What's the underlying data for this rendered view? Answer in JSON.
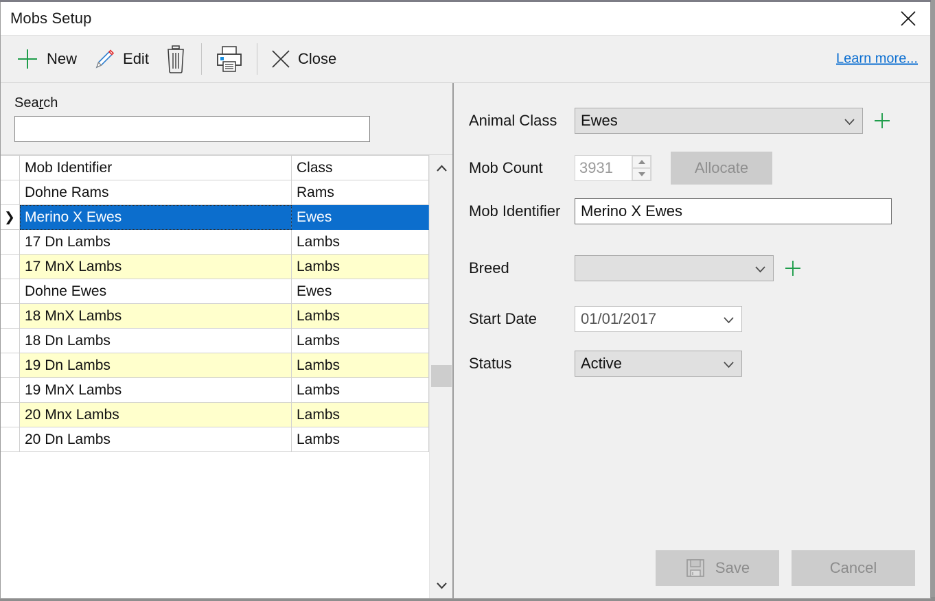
{
  "window": {
    "title": "Mobs Setup",
    "close_icon": "close-x-icon"
  },
  "toolbar": {
    "new_label": "New",
    "edit_label": "Edit",
    "delete_icon": "trash-can-icon",
    "print_icon": "printer-icon",
    "close_label": "Close",
    "close_icon": "x-icon",
    "learn_more_label": "Learn more...",
    "link_color": "#0a6ed1",
    "accent_green": "#1f9d4b"
  },
  "search": {
    "label_pre": "Sea",
    "label_acc": "r",
    "label_post": "ch",
    "value": "",
    "placeholder": ""
  },
  "grid": {
    "columns": [
      "Mob Identifier",
      "Class"
    ],
    "selected_index": 1,
    "rows": [
      {
        "identifier": "Dohne Rams",
        "class": "Rams",
        "highlight": false
      },
      {
        "identifier": "Merino X Ewes",
        "class": "Ewes",
        "highlight": false
      },
      {
        "identifier": "17 Dn Lambs",
        "class": "Lambs",
        "highlight": false
      },
      {
        "identifier": "17 MnX Lambs",
        "class": "Lambs",
        "highlight": true
      },
      {
        "identifier": "Dohne Ewes",
        "class": "Ewes",
        "highlight": false
      },
      {
        "identifier": "18 MnX Lambs",
        "class": "Lambs",
        "highlight": true
      },
      {
        "identifier": "18 Dn Lambs",
        "class": "Lambs",
        "highlight": false
      },
      {
        "identifier": "19 Dn Lambs",
        "class": "Lambs",
        "highlight": true
      },
      {
        "identifier": "19 MnX Lambs",
        "class": "Lambs",
        "highlight": false
      },
      {
        "identifier": "20 Mnx Lambs",
        "class": "Lambs",
        "highlight": true
      },
      {
        "identifier": "20 Dn Lambs",
        "class": "Lambs",
        "highlight": false
      }
    ],
    "selection_color": "#0c6ecd",
    "highlight_color": "#ffffcc"
  },
  "form": {
    "animal_class": {
      "label": "Animal Class",
      "value": "Ewes"
    },
    "mob_count": {
      "label": "Mob Count",
      "value": "3931"
    },
    "allocate": {
      "label": "Allocate"
    },
    "mob_identifier": {
      "label": "Mob Identifier",
      "value": "Merino X Ewes"
    },
    "breed": {
      "label": "Breed",
      "value": ""
    },
    "start_date": {
      "label": "Start Date",
      "value": "01/01/2017"
    },
    "status": {
      "label": "Status",
      "value": "Active"
    }
  },
  "footer": {
    "save_label": "Save",
    "save_icon": "floppy-disk-icon",
    "cancel_label": "Cancel"
  }
}
